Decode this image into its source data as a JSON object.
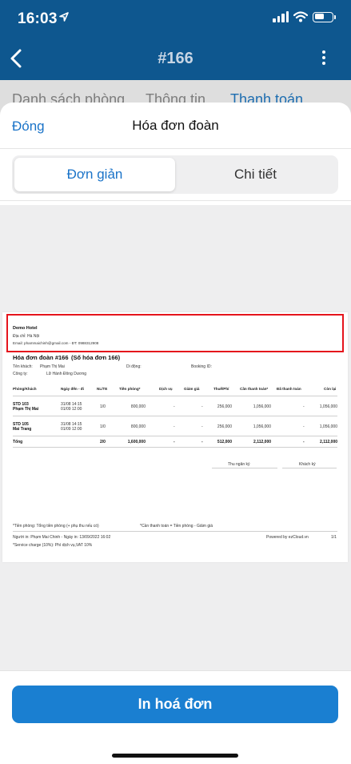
{
  "status_bar": {
    "time": "16:03",
    "battery_level": 0.55
  },
  "nav": {
    "title": "#166"
  },
  "background_tabs": [
    "Danh sách phòng",
    "Thông tin",
    "Thanh toán"
  ],
  "sheet": {
    "close_label": "Đóng",
    "title": "Hóa đơn đoàn",
    "segments": [
      "Đơn giản",
      "Chi tiết"
    ],
    "print_label": "In hoá đơn"
  },
  "invoice": {
    "hotel_name": "Demo Hotel",
    "address": "Địa chỉ: Hà Nội",
    "contact": "Email: phammaichinh@gmail.com - ĐT: 0988312908",
    "title": "Hóa đơn đoàn #166",
    "invoice_no": "(Số hóa đơn 166)",
    "guest_label": "Tên khách:",
    "guest_name": "Phạm Thị Mai",
    "phone_label": "Di động:",
    "booking_label": "Booking ID:",
    "company_label": "Công ty:",
    "company_name": "Lữ Hành Đông Dương",
    "columns": [
      "Phòng/Khách",
      "Ngày đến - đi",
      "NL/TE",
      "Tiền phòng*",
      "Dịch vụ",
      "Giảm giá",
      "Thuế/Phí",
      "Cần thanh toán*",
      "Đã thanh toán",
      "Còn lại"
    ],
    "rows": [
      {
        "room": "STD 103",
        "guest": "Phạm Thị Mai",
        "arrive": "31/08 14:15",
        "depart": "01/09 12:00",
        "pax": "1/0",
        "room_charge": "800,000",
        "service": "-",
        "discount": "-",
        "tax": "256,000",
        "due": "1,056,000",
        "paid": "-",
        "balance": "1,056,000"
      },
      {
        "room": "STD 105",
        "guest": "Mai Trang",
        "arrive": "31/08 14:15",
        "depart": "01/09 12:00",
        "pax": "1/0",
        "room_charge": "800,000",
        "service": "-",
        "discount": "-",
        "tax": "256,000",
        "due": "1,056,000",
        "paid": "-",
        "balance": "1,056,000"
      }
    ],
    "total": {
      "label": "Tổng",
      "pax": "2/0",
      "room_charge": "1,600,000",
      "service": "-",
      "discount": "-",
      "tax": "512,000",
      "due": "2,112,000",
      "paid": "-",
      "balance": "2,112,000"
    },
    "signatures": [
      "Thu ngân ký",
      "Khách ký"
    ],
    "note_room": "*Tiền phòng: Tổng tiền phòng (+ phụ thu nếu có)",
    "note_due": "*Cần thanh toán = Tiền phòng - Giảm giá",
    "printed_by": "Người in: Phạm Mai Chinh - Ngày in: 13/09/2022 16:02",
    "powered_by": "Powered by ezCloud.vn",
    "page": "1/1",
    "service_note": "*Service charge (10%): Phí dịch vụ,VAT 10%"
  }
}
